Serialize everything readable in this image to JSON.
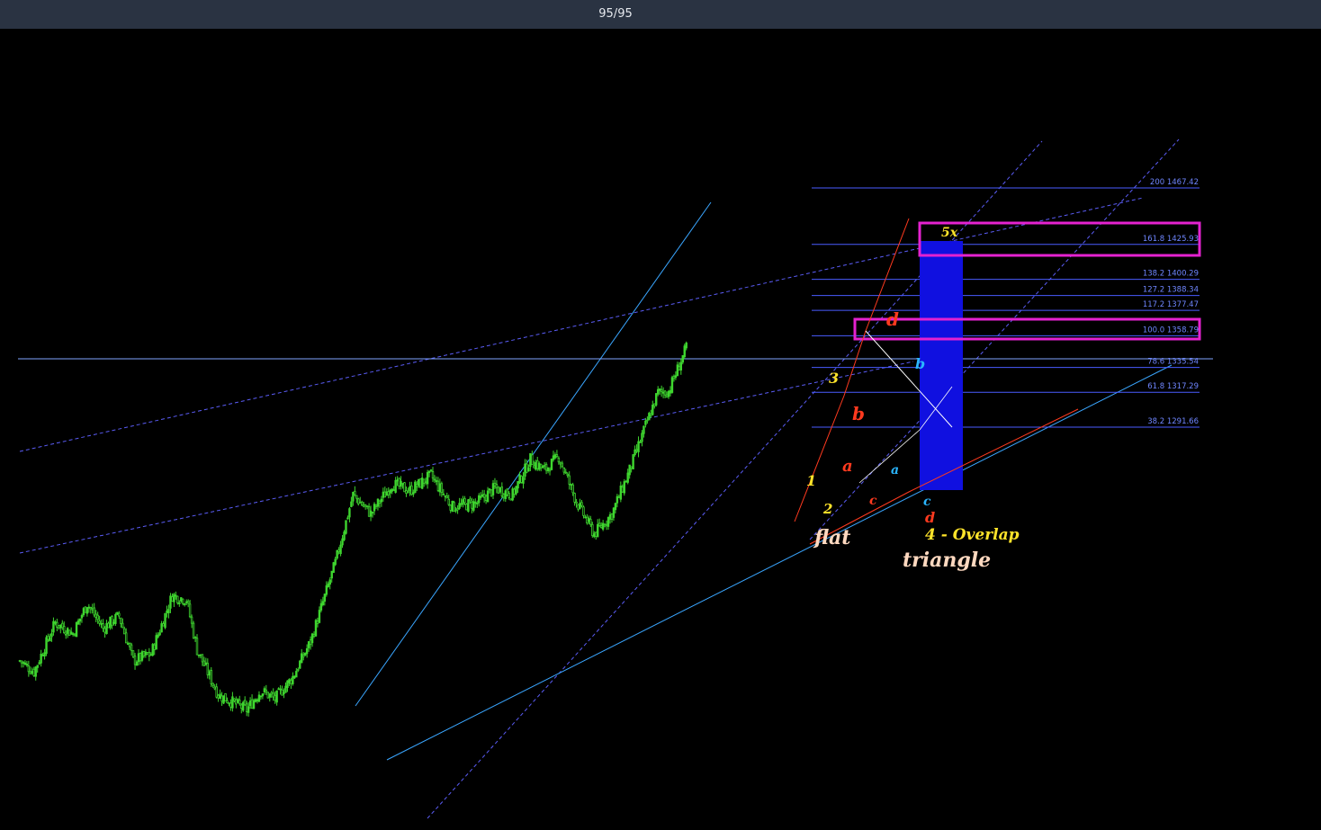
{
  "header": {
    "counter": "95/95"
  },
  "colors": {
    "background": "#000000",
    "bull": "#3fd62f",
    "bear": "#3fd62f",
    "fib": "#4a5cff",
    "box": "#e522d0",
    "target": "#1010e0",
    "trend": "#3aa6ff",
    "red": "#ff3a1f",
    "yellow": "#ffe42a",
    "cyan": "#2ab6ff"
  },
  "chart_data": {
    "type": "candlestick",
    "price_range": [
      1080,
      1512
    ],
    "fib_levels": [
      {
        "ratio": "200",
        "price": "1467.42",
        "label": "200 1467.42",
        "v": 1467.42
      },
      {
        "ratio": "161.8",
        "price": "1425.93",
        "label": "161.8 1425.93",
        "v": 1425.93
      },
      {
        "ratio": "138.2",
        "price": "1400.29",
        "label": "138.2 1400.29",
        "v": 1400.29
      },
      {
        "ratio": "127.2",
        "price": "1388.34",
        "label": "127.2 1388.34",
        "v": 1388.34
      },
      {
        "ratio": "117.2",
        "price": "1377.47",
        "label": "117.2 1377.47",
        "v": 1377.47
      },
      {
        "ratio": "100.0",
        "price": "1358.79",
        "label": "100.0   1358.79",
        "v": 1358.79
      },
      {
        "ratio": "78.6",
        "price": "1335.54",
        "label": "78.6 1335.54",
        "v": 1335.54
      },
      {
        "ratio": "61.8",
        "price": "1317.29",
        "label": "61.8 1317.29",
        "v": 1317.29
      },
      {
        "ratio": "38.2",
        "price": "1291.66",
        "label": "38.2 1291.66",
        "v": 1291.66
      }
    ],
    "anchors": [
      {
        "i": 0,
        "p": 1120
      },
      {
        "i": 8,
        "p": 1112
      },
      {
        "i": 20,
        "p": 1148
      },
      {
        "i": 30,
        "p": 1140
      },
      {
        "i": 38,
        "p": 1162
      },
      {
        "i": 47,
        "p": 1144
      },
      {
        "i": 56,
        "p": 1153
      },
      {
        "i": 64,
        "p": 1120
      },
      {
        "i": 74,
        "p": 1125
      },
      {
        "i": 86,
        "p": 1168
      },
      {
        "i": 94,
        "p": 1165
      },
      {
        "i": 100,
        "p": 1128
      },
      {
        "i": 112,
        "p": 1095
      },
      {
        "i": 128,
        "p": 1084
      },
      {
        "i": 136,
        "p": 1098
      },
      {
        "i": 144,
        "p": 1092
      },
      {
        "i": 154,
        "p": 1108
      },
      {
        "i": 164,
        "p": 1134
      },
      {
        "i": 178,
        "p": 1192
      },
      {
        "i": 188,
        "p": 1242
      },
      {
        "i": 198,
        "p": 1228
      },
      {
        "i": 210,
        "p": 1250
      },
      {
        "i": 220,
        "p": 1245
      },
      {
        "i": 232,
        "p": 1256
      },
      {
        "i": 244,
        "p": 1233
      },
      {
        "i": 258,
        "p": 1236
      },
      {
        "i": 268,
        "p": 1247
      },
      {
        "i": 278,
        "p": 1242
      },
      {
        "i": 288,
        "p": 1268
      },
      {
        "i": 296,
        "p": 1260
      },
      {
        "i": 304,
        "p": 1270
      },
      {
        "i": 314,
        "p": 1237
      },
      {
        "i": 324,
        "p": 1213
      },
      {
        "i": 334,
        "p": 1228
      },
      {
        "i": 344,
        "p": 1260
      },
      {
        "i": 352,
        "p": 1289
      },
      {
        "i": 360,
        "p": 1317
      },
      {
        "i": 366,
        "p": 1318
      },
      {
        "i": 376,
        "p": 1350
      }
    ],
    "annotations": [
      {
        "id": "flat",
        "text": "flat",
        "color": "#ffd9c0",
        "size": 22
      },
      {
        "id": "triangle",
        "text": "triangle",
        "color": "#ffd9c0",
        "size": 22
      },
      {
        "id": "overlap",
        "text": "4 - Overlap",
        "color": "#ffe42a",
        "size": 17
      },
      {
        "id": "w5x",
        "text": "5x",
        "color": "#ffe42a",
        "size": 14
      },
      {
        "id": "w1",
        "text": "1",
        "color": "#ffe42a",
        "size": 16
      },
      {
        "id": "w2",
        "text": "2",
        "color": "#ffe42a",
        "size": 15
      },
      {
        "id": "w3",
        "text": "3",
        "color": "#ffe42a",
        "size": 16
      },
      {
        "id": "ra",
        "text": "a",
        "color": "#ff3a1f",
        "size": 18
      },
      {
        "id": "rb",
        "text": "b",
        "color": "#ff3a1f",
        "size": 20
      },
      {
        "id": "rc",
        "text": "c",
        "color": "#ff3a1f",
        "size": 14
      },
      {
        "id": "rd",
        "text": "d",
        "color": "#ff3a1f",
        "size": 20
      },
      {
        "id": "rd2",
        "text": "d",
        "color": "#ff3a1f",
        "size": 16
      },
      {
        "id": "ca",
        "text": "a",
        "color": "#2ab6ff",
        "size": 14
      },
      {
        "id": "cb",
        "text": "b",
        "color": "#2ab6ff",
        "size": 16
      },
      {
        "id": "cc",
        "text": "c",
        "color": "#2ab6ff",
        "size": 14
      }
    ]
  }
}
